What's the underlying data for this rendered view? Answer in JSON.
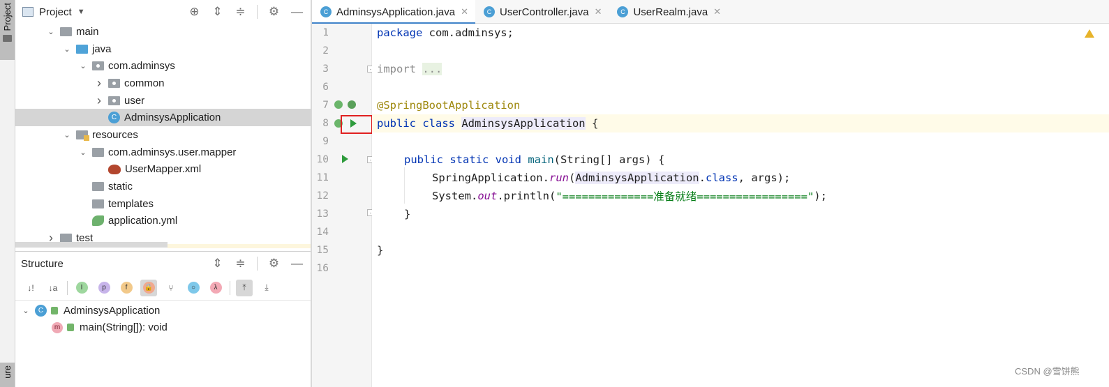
{
  "sidebar_strip": {
    "project_tab": "Project",
    "structure_tab": "ure"
  },
  "project": {
    "title": "Project",
    "tree": [
      {
        "label": "main",
        "icon": "folder-icon",
        "level": 2,
        "arrow": "down"
      },
      {
        "label": "java",
        "icon": "source-folder-icon",
        "level": 3,
        "arrow": "down"
      },
      {
        "label": "com.adminsys",
        "icon": "package-icon",
        "level": 4,
        "arrow": "down"
      },
      {
        "label": "common",
        "icon": "package-icon",
        "level": 5,
        "arrow": "right"
      },
      {
        "label": "user",
        "icon": "package-icon",
        "level": 5,
        "arrow": "right"
      },
      {
        "label": "AdminsysApplication",
        "icon": "spring-class-icon",
        "level": 5,
        "arrow": "",
        "selected": true
      },
      {
        "label": "resources",
        "icon": "resources-folder-icon",
        "level": 3,
        "arrow": "down"
      },
      {
        "label": "com.adminsys.user.mapper",
        "icon": "folder-icon",
        "level": 4,
        "arrow": "down"
      },
      {
        "label": "UserMapper.xml",
        "icon": "mybatis-xml-icon",
        "level": 5,
        "arrow": ""
      },
      {
        "label": "static",
        "icon": "folder-icon",
        "level": 4,
        "arrow": ""
      },
      {
        "label": "templates",
        "icon": "folder-icon",
        "level": 4,
        "arrow": ""
      },
      {
        "label": "application.yml",
        "icon": "spring-yml-icon",
        "level": 4,
        "arrow": ""
      },
      {
        "label": "test",
        "icon": "folder-icon",
        "level": 2,
        "arrow": "right"
      }
    ]
  },
  "structure": {
    "title": "Structure",
    "toolbar": [
      {
        "name": "sort-by-visibility-button",
        "glyph": "↓!"
      },
      {
        "name": "sort-alpha-button",
        "glyph": "↓a"
      },
      {
        "name": "show-inherited-button",
        "glyph": "I"
      },
      {
        "name": "show-properties-button",
        "glyph": "p"
      },
      {
        "name": "show-fields-button",
        "glyph": "f"
      },
      {
        "name": "show-non-public-button",
        "glyph": "🔒"
      },
      {
        "name": "show-inheritance-button",
        "glyph": "⑂"
      },
      {
        "name": "show-anonymous-button",
        "glyph": "○"
      },
      {
        "name": "show-lambdas-button",
        "glyph": "λ"
      },
      {
        "name": "autoscroll-to-source-button",
        "glyph": "⤒"
      },
      {
        "name": "autoscroll-from-source-button",
        "glyph": "⤓"
      }
    ],
    "items": [
      {
        "label": "AdminsysApplication",
        "icon": "spring-class-icon"
      },
      {
        "label": "main(String[]): void",
        "icon": "method-icon"
      }
    ]
  },
  "editor": {
    "tabs": [
      {
        "label": "AdminsysApplication.java",
        "active": true
      },
      {
        "label": "UserController.java",
        "active": false
      },
      {
        "label": "UserRealm.java",
        "active": false
      }
    ],
    "line_numbers": [
      "1",
      "2",
      "3",
      "6",
      "7",
      "8",
      "9",
      "10",
      "11",
      "12",
      "13",
      "14",
      "15",
      "16"
    ],
    "code": {
      "l1_kw": "package",
      "l1_rest": " com.adminsys;",
      "l3_kw": "import",
      "l3_fold": "...",
      "l7_annot": "@SpringBootApplication",
      "l8_kw": "public class",
      "l8_name": "AdminsysApplication",
      "l8_rest": " {",
      "l10_kw": "public static void",
      "l10_fn": "main",
      "l10_rest": "(String[] args) {",
      "l11_a": "SpringApplication.",
      "l11_run": "run",
      "l11_b": "(",
      "l11_cls": "AdminsysApplication",
      "l11_c": ".",
      "l11_kwclass": "class",
      "l11_d": ", args);",
      "l12_a": "System.",
      "l12_out": "out",
      "l12_b": ".println(",
      "l12_str": "\"==============准备就绪=================\"",
      "l12_c": ");",
      "l13": "}",
      "l15": "}"
    }
  },
  "watermark": "CSDN @雪饼熊"
}
